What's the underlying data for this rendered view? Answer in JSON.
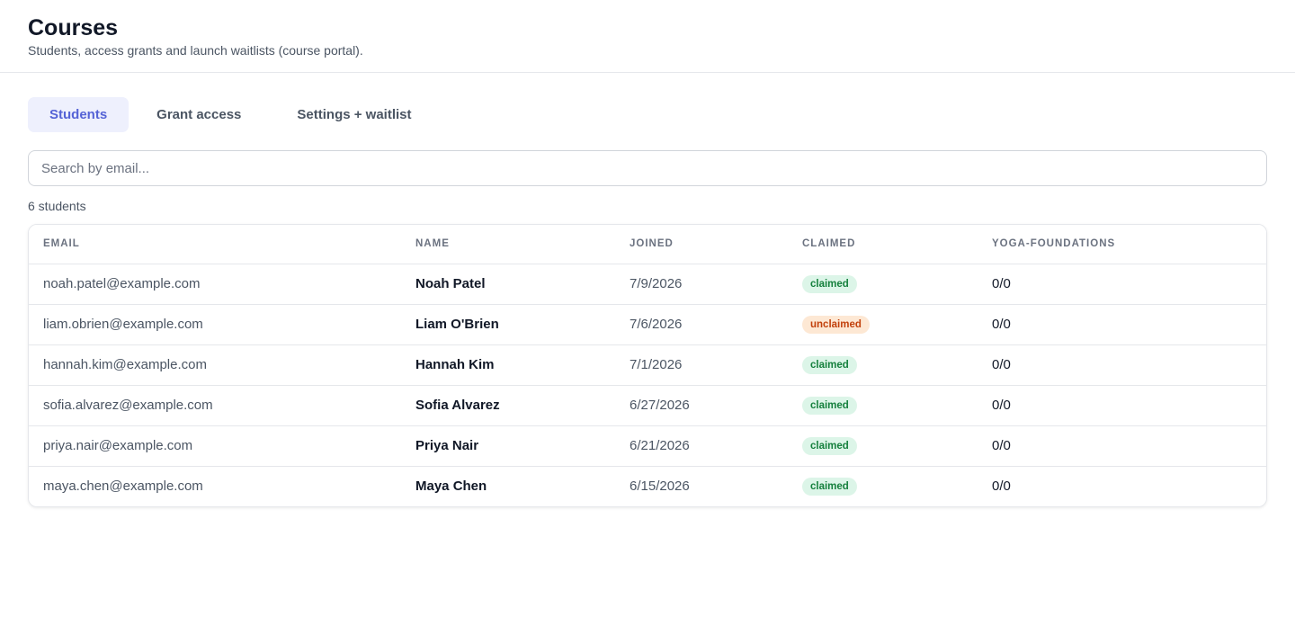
{
  "header": {
    "title": "Courses",
    "subtitle": "Students, access grants and launch waitlists (course portal)."
  },
  "tabs": [
    {
      "label": "Students",
      "active": true
    },
    {
      "label": "Grant access",
      "active": false
    },
    {
      "label": "Settings + waitlist",
      "active": false
    }
  ],
  "search": {
    "placeholder": "Search by email...",
    "value": ""
  },
  "count_label": "6 students",
  "table": {
    "columns": [
      "EMAIL",
      "NAME",
      "JOINED",
      "CLAIMED",
      "YOGA-FOUNDATIONS"
    ],
    "rows": [
      {
        "email": "noah.patel@example.com",
        "name": "Noah Patel",
        "joined": "7/9/2026",
        "claimed": "claimed",
        "progress": "0/0"
      },
      {
        "email": "liam.obrien@example.com",
        "name": "Liam O'Brien",
        "joined": "7/6/2026",
        "claimed": "unclaimed",
        "progress": "0/0"
      },
      {
        "email": "hannah.kim@example.com",
        "name": "Hannah Kim",
        "joined": "7/1/2026",
        "claimed": "claimed",
        "progress": "0/0"
      },
      {
        "email": "sofia.alvarez@example.com",
        "name": "Sofia Alvarez",
        "joined": "6/27/2026",
        "claimed": "claimed",
        "progress": "0/0"
      },
      {
        "email": "priya.nair@example.com",
        "name": "Priya Nair",
        "joined": "6/21/2026",
        "claimed": "claimed",
        "progress": "0/0"
      },
      {
        "email": "maya.chen@example.com",
        "name": "Maya Chen",
        "joined": "6/15/2026",
        "claimed": "claimed",
        "progress": "0/0"
      }
    ]
  },
  "colors": {
    "accent": "#5563d6",
    "active_tab_bg": "#eef0fd",
    "claimed_bg": "#dcf5e8",
    "claimed_text": "#15803d",
    "unclaimed_bg": "#fde8d4",
    "unclaimed_text": "#c2410c"
  }
}
